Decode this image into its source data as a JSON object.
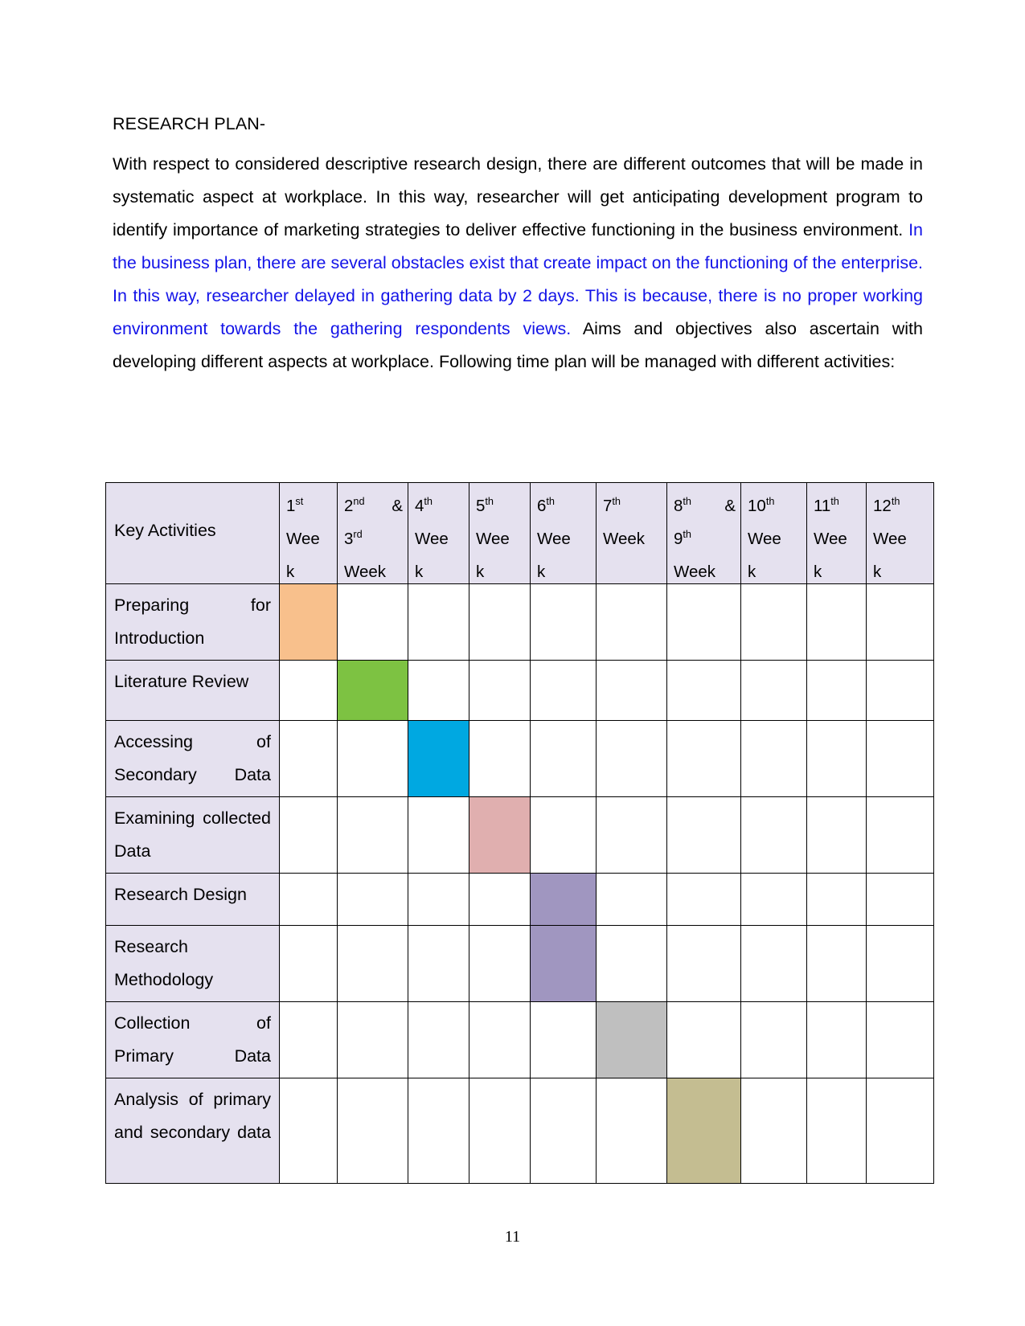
{
  "document": {
    "heading": "RESEARCH PLAN-",
    "page_number": "11",
    "paragraph": {
      "part1": "With respect to considered descriptive research design, there are different outcomes that will be made in systematic aspect at workplace. In this way, researcher will get anticipating development program to identify importance of marketing strategies to deliver effective functioning in the business environment.",
      "part2_blue": "In the business plan, there are several obstacles exist that create impact on the functioning of the enterprise. In this way, researcher delayed in gathering data by 2 days. This is because, there is no proper working environment towards the gathering respondents views.",
      "part3": "Aims and objectives also ascertain with developing different aspects at workplace. Following time plan will be managed with different activities:"
    }
  },
  "table": {
    "row_header_label": "Key Activities",
    "columns": [
      {
        "ordinal": "1",
        "suffix": "st",
        "line1_extra": "",
        "line2": "Wee",
        "line3": "k"
      },
      {
        "ordinal": "2",
        "suffix": "nd",
        "line1_extra": "&",
        "line2": "3rd",
        "line3": "Week"
      },
      {
        "ordinal": "4",
        "suffix": "th",
        "line1_extra": "",
        "line2": "Wee",
        "line3": "k"
      },
      {
        "ordinal": "5",
        "suffix": "th",
        "line1_extra": "",
        "line2": "Wee",
        "line3": "k"
      },
      {
        "ordinal": "6",
        "suffix": "th",
        "line1_extra": "",
        "line2": "Wee",
        "line3": "k"
      },
      {
        "ordinal": "7",
        "suffix": "th",
        "line1_extra": "",
        "line2": "Week",
        "line3": ""
      },
      {
        "ordinal": "8",
        "suffix": "th",
        "line1_extra": "&",
        "line2": "9th",
        "line3": "Week"
      },
      {
        "ordinal": "10",
        "suffix": "th",
        "line1_extra": "",
        "line2": "Wee",
        "line3": "k"
      },
      {
        "ordinal": "11",
        "suffix": "th",
        "line1_extra": "",
        "line2": "Wee",
        "line3": "k"
      },
      {
        "ordinal": "12",
        "suffix": "th",
        "line1_extra": "",
        "line2": "Wee",
        "line3": "k"
      }
    ],
    "column_labels": [
      "1st Week",
      "2nd & 3rd Week",
      "4th Week",
      "5th Week",
      "6th Week",
      "7th Week",
      "8th & 9th Week",
      "10th Week",
      "11th Week",
      "12th Week"
    ],
    "rows": [
      {
        "activity": "Preparing for Introduction",
        "filled_column": 1,
        "color": "#F8C08C"
      },
      {
        "activity": "Literature Review",
        "filled_column": 2,
        "color": "#7DC242"
      },
      {
        "activity": "Accessing of Secondary Data",
        "filled_column": 3,
        "color": "#00A8E1"
      },
      {
        "activity": "Examining collected Data",
        "filled_column": 4,
        "color": "#E0AFAF"
      },
      {
        "activity": "Research Design",
        "filled_column": 5,
        "color": "#A096C0"
      },
      {
        "activity": "Research Methodology",
        "filled_column": 5,
        "color": "#A096C0"
      },
      {
        "activity": "Collection of Primary Data",
        "filled_column": 6,
        "color": "#BFBFBF"
      },
      {
        "activity": "Analysis of primary and secondary data",
        "filled_column": 7,
        "color": "#C4BD91"
      }
    ],
    "colors": {
      "header_fill": "#E5E1EF",
      "activity_fill": "#E5E1EF",
      "border": "#000000",
      "blue_text": "#1414E8"
    }
  }
}
